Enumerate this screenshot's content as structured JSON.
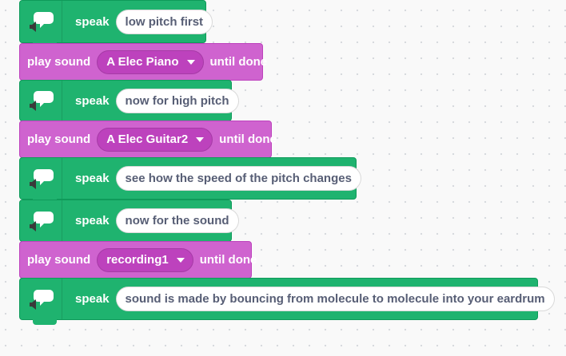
{
  "colors": {
    "speak_block": "#1fb36f",
    "sound_block": "#cf63cf",
    "dropdown": "#bd42bd",
    "canvas": "#f9f9f9"
  },
  "icons": {
    "speak": "speech-bubble-speaker-icon",
    "dropdown": "caret-down-icon"
  },
  "blocks": [
    {
      "type": "speak",
      "label": "speak",
      "text": "low pitch first"
    },
    {
      "type": "play_sound",
      "label": "play sound",
      "sound": "A Elec Piano",
      "suffix": "until done"
    },
    {
      "type": "speak",
      "label": "speak",
      "text": "now for high pitch"
    },
    {
      "type": "play_sound",
      "label": "play sound",
      "sound": "A Elec Guitar2",
      "suffix": "until done"
    },
    {
      "type": "speak",
      "label": "speak",
      "text": "see how the speed of the pitch changes"
    },
    {
      "type": "speak",
      "label": "speak",
      "text": "now for the sound"
    },
    {
      "type": "play_sound",
      "label": "play sound",
      "sound": "recording1",
      "suffix": "until done"
    },
    {
      "type": "speak",
      "label": "speak",
      "text": "sound is made by bouncing from molecule to molecule into your eardrum"
    }
  ]
}
